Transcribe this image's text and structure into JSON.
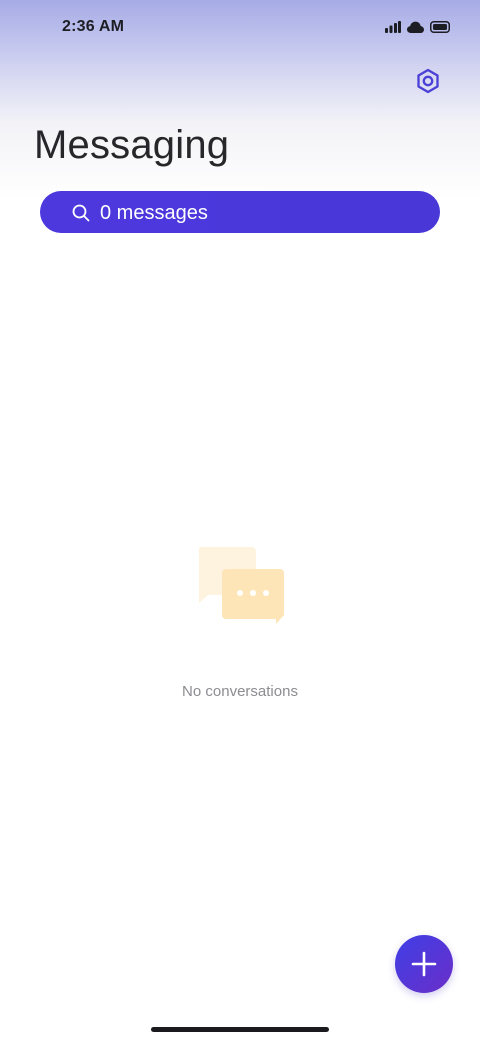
{
  "status_bar": {
    "time": "2:36 AM",
    "icons": [
      "signal-icon",
      "cloud-icon",
      "battery-icon"
    ]
  },
  "header": {
    "title": "Messaging",
    "settings_icon": "settings-icon"
  },
  "search": {
    "label": "0 messages",
    "icon": "search-icon"
  },
  "empty_state": {
    "icon": "chat-bubbles-icon",
    "text": "No conversations"
  },
  "fab": {
    "icon": "plus-icon"
  },
  "colors": {
    "accent": "#4937d8",
    "fab_start": "#3f3fe6",
    "fab_end": "#6a2ec8",
    "title": "#26262b",
    "empty_text": "#8c8c92",
    "illustration": "#fde5b8"
  }
}
